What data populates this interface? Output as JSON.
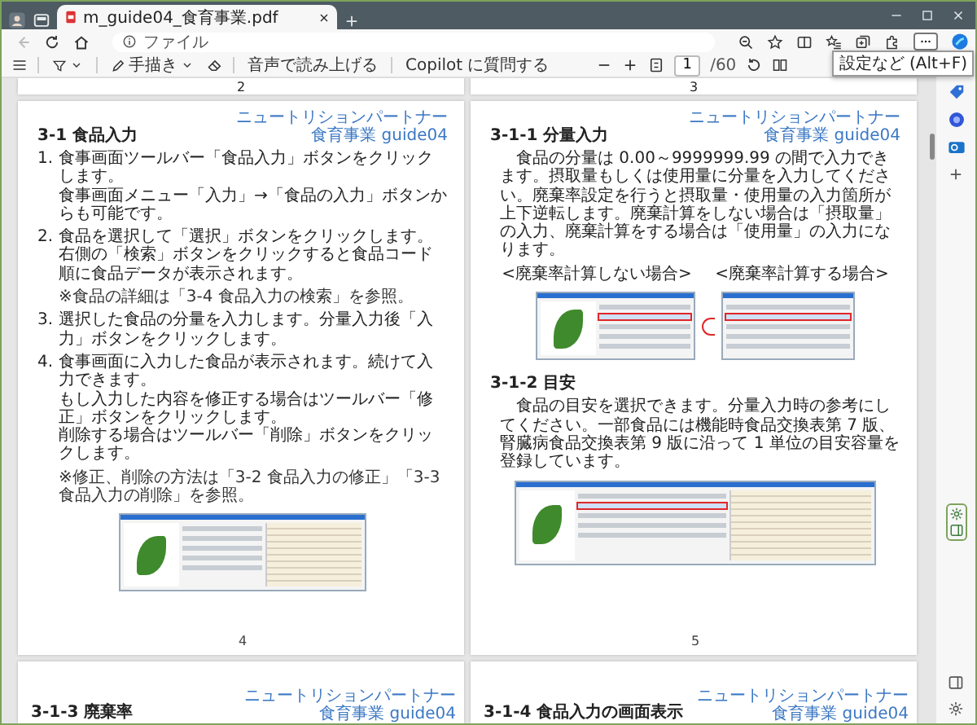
{
  "window": {
    "tabs": [
      {
        "title": "m_guide04_食育事業.pdf",
        "selected": true
      }
    ]
  },
  "address_bar": {
    "back": {
      "disabled": true
    },
    "scheme_label": "ファイル"
  },
  "pdf_toolbar": {
    "draw_label": "手描き",
    "read_aloud_label": "音声で読み上げる",
    "copilot_label": "Copilot に質問する",
    "page_input": "1",
    "page_count": "/60"
  },
  "tooltip": "設定など (Alt+F)",
  "top_pages": [
    {
      "number": "2"
    },
    {
      "number": "3"
    }
  ],
  "pages": [
    {
      "header_lines": [
        "ニュートリションパートナー",
        "食育事業 guide04"
      ],
      "title": "3-1 食品入力",
      "blocks": [
        {
          "kind": "item",
          "number": "1.",
          "lines": [
            "食事画面ツールバー「食品入力」ボタンをクリックします。",
            "食事画面メニュー「入力」→「食品の入力」ボタンからも可能です。"
          ]
        },
        {
          "kind": "item",
          "number": "2.",
          "lines": [
            "食品を選択して「選択」ボタンをクリックします。",
            "右側の「検索」ボタンをクリックすると食品コード順に食品データが表示されます。"
          ]
        },
        {
          "kind": "note",
          "text": "※食品の詳細は「3-4 食品入力の検索」を参照。"
        },
        {
          "kind": "item",
          "number": "3.",
          "lines": [
            "選択した食品の分量を入力します。分量入力後「入力」ボタンをクリックします。"
          ]
        },
        {
          "kind": "item",
          "number": "4.",
          "lines": [
            "食事画面に入力した食品が表示されます。続けて入力できます。",
            "もし入力した内容を修正する場合はツールバー「修正」ボタンをクリックします。",
            "削除する場合はツールバー「削除」ボタンをクリックします。"
          ]
        },
        {
          "kind": "note",
          "text": "※修正、削除の方法は「3-2 食品入力の修正」「3-3 食品入力の削除」を参照。"
        },
        {
          "kind": "dialog-image"
        }
      ],
      "number": "4"
    },
    {
      "header_lines": [
        "ニュートリションパートナー",
        "食育事業 guide04"
      ],
      "title": "3-1-1 分量入力",
      "blocks": [
        {
          "kind": "paragraph",
          "text": "食品の分量は 0.00～9999999.99 の間で入力できます。摂取量もしくは使用量に分量を入力してください。廃棄率設定を行うと摂取量・使用量の入力箇所が上下逆転します。廃棄計算をしない場合は「摂取量」の入力、廃棄計算をする場合は「使用量」の入力になります。"
        },
        {
          "kind": "captions",
          "items": [
            "<廃棄率計算しない場合>",
            "<廃棄率計算する場合>"
          ]
        },
        {
          "kind": "pair-image"
        },
        {
          "kind": "heading",
          "text": "3-1-2 目安"
        },
        {
          "kind": "paragraph",
          "text": "食品の目安を選択できます。分量入力時の参考にしてください。一部食品には機能時食品交換表第 7 版、腎臓病食品交換表第 9 版に沿って 1 単位の目安容量を登録しています。"
        },
        {
          "kind": "list-image"
        }
      ],
      "number": "5"
    }
  ],
  "bottom_pages": [
    {
      "header_lines": [
        "ニュートリションパートナー",
        "食育事業 guide04"
      ],
      "title": "3-1-3 廃棄率"
    },
    {
      "header_lines": [
        "ニュートリションパートナー",
        "食育事業 guide04"
      ],
      "title": "3-1-4 食品入力の画面表示"
    }
  ]
}
